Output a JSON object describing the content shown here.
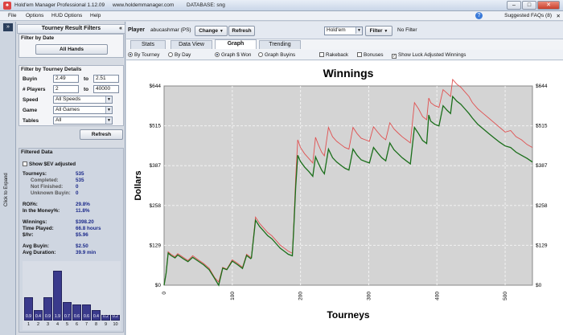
{
  "window": {
    "title": "Hold'em Manager Professional 1.12.09",
    "site": "www.holdemmanager.com",
    "database": "DATABASE: sng"
  },
  "menu": {
    "items": [
      "File",
      "Options",
      "HUD Options",
      "Help"
    ],
    "suggested": "Suggested FAQs (8)"
  },
  "toolbar": {
    "player_label": "Player",
    "player_name": "abucashmar (PS)",
    "change_label": "Change",
    "refresh_label": "Refresh",
    "game_value": "Hold'em",
    "filter_label": "Filter",
    "filter_status": "No Filter"
  },
  "tabs": [
    "Stats",
    "Data View",
    "Graph",
    "Trending"
  ],
  "active_tab": "Graph",
  "options": {
    "by_tourney": "By Tourney",
    "by_day": "By Day",
    "graph_won": "Graph $ Won",
    "graph_buyins": "Graph Buyins",
    "rakeback": "Rakeback",
    "bonuses": "Bonuses",
    "show_luck": "Show Luck Adjusted Winnings"
  },
  "sidebar": {
    "expand_label": "Click to Expand",
    "header": "Tourney Result Filters",
    "filter_by_date": {
      "title": "Filter by Date",
      "button": "All Hands"
    },
    "filter_by_details": {
      "title": "Filter by Tourney Details",
      "buyin_label": "Buyin",
      "buyin_from": "2.49",
      "to1": "to",
      "buyin_to": "2.51",
      "players_label": "# Players",
      "players_from": "2",
      "to2": "to",
      "players_to": "40000",
      "speed_label": "Speed",
      "speed_value": "All Speeds",
      "game_label": "Game",
      "game_value": "All Games",
      "tables_label": "Tables",
      "tables_value": "All"
    },
    "refresh_label": "Refresh",
    "filtered_data": {
      "title": "Filtered Data",
      "show_ev": "Show $EV adjusted",
      "tourneys_label": "Tourneys:",
      "tourneys": "535",
      "completed_label": "Completed:",
      "completed": "535",
      "not_finished_label": "Not Finished:",
      "not_finished": "0",
      "unknown_label": "Unknown Buyin:",
      "unknown": "0",
      "roi_label": "ROI%:",
      "roi": "29.8%",
      "itm_label": "In the Money%:",
      "itm": "11.8%",
      "winnings_label": "Winnings:",
      "winnings": "$398.20",
      "time_label": "Time Played:",
      "time": "66.8 hours",
      "hr_label": "$/hr:",
      "hr": "$5.96",
      "avg_buyin_label": "Avg Buyin:",
      "avg_buyin": "$2.50",
      "avg_dur_label": "Avg Duration:",
      "avg_dur": "39.9  min"
    },
    "histogram": {
      "labels": [
        "1",
        "2",
        "3",
        "4",
        "5",
        "6",
        "7",
        "8",
        "9",
        "10"
      ],
      "values": [
        "0.9",
        "0.4",
        "0.9",
        "1.9",
        "0.7",
        "0.6",
        "0.6",
        "0.4",
        "0.2",
        "0.2"
      ],
      "heights": [
        0.47,
        0.21,
        0.47,
        1.0,
        0.37,
        0.32,
        0.32,
        0.21,
        0.11,
        0.11
      ]
    }
  },
  "chart_data": {
    "type": "line",
    "title": "Winnings",
    "xlabel": "Tourneys",
    "ylabel": "Dollars",
    "ylim": [
      0,
      644
    ],
    "xlim": [
      0,
      540
    ],
    "yticks": [
      "$0",
      "$129",
      "$258",
      "$387",
      "$515",
      "$644"
    ],
    "xticks": [
      "0",
      "100",
      "200",
      "300",
      "400",
      "500"
    ],
    "grid": true,
    "colors": {
      "winnings": "#1a6e1a",
      "luck": "#e05050",
      "background": "#d4d4d4"
    },
    "series": [
      {
        "key": "luck",
        "x": [
          0,
          3,
          6,
          10,
          16,
          20,
          28,
          35,
          42,
          50,
          58,
          66,
          74,
          80,
          86,
          92,
          100,
          108,
          115,
          121,
          127,
          128,
          134,
          140,
          146,
          152,
          158,
          164,
          170,
          176,
          182,
          188,
          190,
          193,
          196,
          200,
          206,
          212,
          218,
          222,
          226,
          231,
          235,
          241,
          247,
          253,
          259,
          265,
          271,
          277,
          283,
          289,
          295,
          301,
          307,
          313,
          319,
          325,
          331,
          337,
          343,
          349,
          355,
          361,
          367,
          373,
          379,
          385,
          388,
          391,
          397,
          403,
          409,
          415,
          420,
          423,
          429,
          435,
          441,
          447,
          452,
          460,
          468,
          476,
          484,
          492,
          500,
          508,
          516,
          524,
          532,
          540
        ],
        "y": [
          0,
          40,
          108,
          100,
          92,
          102,
          90,
          80,
          95,
          82,
          70,
          55,
          25,
          10,
          58,
          52,
          82,
          70,
          58,
          100,
          90,
          92,
          220,
          200,
          185,
          170,
          160,
          145,
          130,
          120,
          110,
          103,
          190,
          350,
          470,
          445,
          425,
          410,
          395,
          478,
          455,
          430,
          418,
          510,
          480,
          465,
          455,
          445,
          440,
          510,
          490,
          475,
          470,
          465,
          512,
          495,
          480,
          470,
          525,
          505,
          492,
          480,
          470,
          460,
          590,
          570,
          545,
          535,
          605,
          590,
          580,
          575,
          632,
          620,
          610,
          665,
          650,
          640,
          625,
          610,
          590,
          570,
          555,
          540,
          525,
          510,
          495,
          500,
          480,
          470,
          455,
          445
        ]
      },
      {
        "key": "winnings",
        "x": [
          0,
          3,
          6,
          10,
          16,
          20,
          28,
          35,
          42,
          50,
          58,
          66,
          74,
          80,
          86,
          92,
          100,
          108,
          115,
          121,
          127,
          128,
          134,
          140,
          146,
          152,
          158,
          164,
          170,
          176,
          182,
          188,
          190,
          193,
          196,
          200,
          206,
          212,
          218,
          222,
          226,
          231,
          235,
          241,
          247,
          253,
          259,
          265,
          271,
          277,
          283,
          289,
          295,
          301,
          307,
          313,
          319,
          325,
          331,
          337,
          343,
          349,
          355,
          361,
          367,
          373,
          379,
          385,
          388,
          391,
          397,
          403,
          409,
          415,
          420,
          423,
          429,
          435,
          441,
          447,
          452,
          460,
          468,
          476,
          484,
          492,
          500,
          508,
          516,
          524,
          532,
          540
        ],
        "y": [
          0,
          38,
          104,
          96,
          88,
          98,
          86,
          76,
          90,
          78,
          66,
          50,
          22,
          0,
          55,
          50,
          78,
          66,
          54,
          96,
          86,
          88,
          210,
          190,
          175,
          160,
          150,
          135,
          120,
          110,
          100,
          95,
          175,
          320,
          420,
          400,
          382,
          368,
          352,
          415,
          395,
          372,
          360,
          440,
          412,
          398,
          388,
          378,
          372,
          440,
          420,
          405,
          400,
          395,
          445,
          428,
          412,
          402,
          460,
          438,
          425,
          412,
          402,
          392,
          510,
          490,
          468,
          458,
          550,
          530,
          520,
          515,
          580,
          565,
          555,
          610,
          595,
          585,
          570,
          555,
          540,
          520,
          505,
          490,
          476,
          462,
          450,
          445,
          430,
          420,
          410,
          398
        ]
      }
    ]
  }
}
